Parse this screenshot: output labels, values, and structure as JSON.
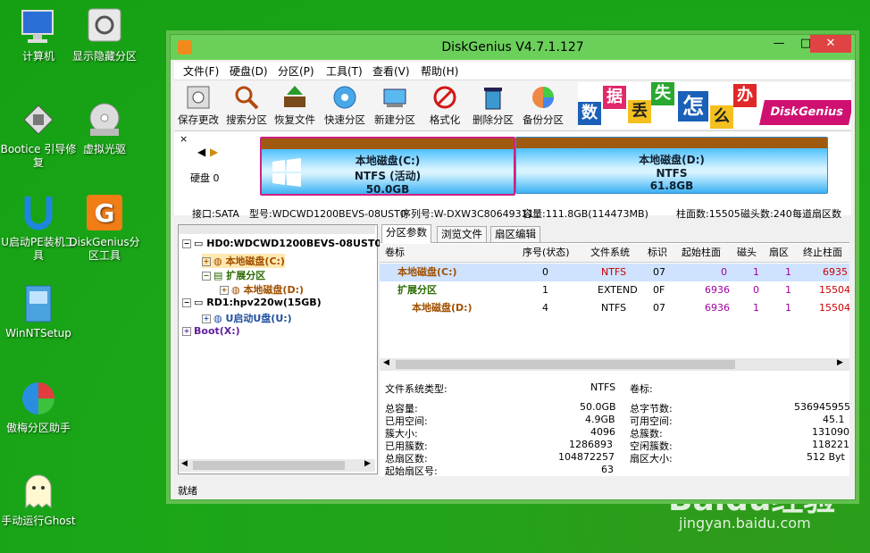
{
  "desktop": {
    "icons": [
      {
        "label": "计算机"
      },
      {
        "label": "显示隐藏分区"
      },
      {
        "label": "Bootice 引导修复"
      },
      {
        "label": "虚拟光驱"
      },
      {
        "label": "U启动PE装机工具"
      },
      {
        "label": "DiskGenius分区工具"
      },
      {
        "label": "WinNTSetup"
      },
      {
        "label": "傲梅分区助手"
      },
      {
        "label": "手动运行Ghost"
      }
    ],
    "watermark": "Baidu经验",
    "watermark_url": "jingyan.baidu.com"
  },
  "window": {
    "title": "DiskGenius V4.7.1.127",
    "minimize": "—",
    "maximize": "□",
    "close": "✕"
  },
  "menu": [
    "文件(F)",
    "硬盘(D)",
    "分区(P)",
    "工具(T)",
    "查看(V)",
    "帮助(H)"
  ],
  "toolbar": [
    {
      "label": "保存更改",
      "icon": "save-icon"
    },
    {
      "label": "搜索分区",
      "icon": "search-icon"
    },
    {
      "label": "恢复文件",
      "icon": "recover-icon"
    },
    {
      "label": "快速分区",
      "icon": "quick-partition-icon"
    },
    {
      "label": "新建分区",
      "icon": "new-partition-icon"
    },
    {
      "label": "格式化",
      "icon": "format-icon"
    },
    {
      "label": "删除分区",
      "icon": "delete-icon"
    },
    {
      "label": "备份分区",
      "icon": "backup-icon"
    }
  ],
  "banner": {
    "chars": [
      "数",
      "据",
      "丢",
      "失",
      "怎",
      "么",
      "办"
    ],
    "brand": "DiskGenius"
  },
  "diskbar": {
    "close": "×",
    "disk_label": "硬盘 0",
    "partitions": [
      {
        "name": "本地磁盘(C:)",
        "fs": "NTFS (活动)",
        "size": "50.0GB"
      },
      {
        "name": "本地磁盘(D:)",
        "fs": "NTFS",
        "size": "61.8GB"
      }
    ]
  },
  "diskinfo": {
    "interface": "接口:SATA",
    "model": "型号:WDCWD1200BEVS-08UST0",
    "serial": "序列号:W-DXW3C80649311",
    "capacity": "容量:111.8GB(114473MB)",
    "cylinders": "柱面数:15505",
    "heads": "磁头数:240",
    "sectors": "每道扇区数"
  },
  "tree": [
    {
      "text": "HD0:WDCWD1200BEVS-08UST0",
      "level": 0,
      "exp": "−"
    },
    {
      "text": "本地磁盘(C:)",
      "level": 1,
      "exp": "+"
    },
    {
      "text": "扩展分区",
      "level": 1,
      "exp": "−"
    },
    {
      "text": "本地磁盘(D:)",
      "level": 2,
      "exp": "+"
    },
    {
      "text": "RD1:hpv220w(15GB)",
      "level": 0,
      "exp": "−"
    },
    {
      "text": "U启动U盘(U:)",
      "level": 1,
      "exp": "+"
    },
    {
      "text": "Boot(X:)",
      "level": 0,
      "exp": "+"
    }
  ],
  "tabs": [
    "分区参数",
    "浏览文件",
    "扇区编辑"
  ],
  "table": {
    "headers": [
      "卷标",
      "序号(状态)",
      "文件系统",
      "标识",
      "起始柱面",
      "磁头",
      "扇区",
      "终止柱面"
    ],
    "rows": [
      [
        "本地磁盘(C:)",
        "0",
        "NTFS",
        "07",
        "0",
        "1",
        "1",
        "6935"
      ],
      [
        "扩展分区",
        "1",
        "EXTEND",
        "0F",
        "6936",
        "0",
        "1",
        "15504"
      ],
      [
        "本地磁盘(D:)",
        "4",
        "NTFS",
        "07",
        "6936",
        "1",
        "1",
        "15504"
      ]
    ]
  },
  "props": {
    "fs_type_label": "文件系统类型:",
    "fs_type": "NTFS",
    "vol_label": "卷标:",
    "left": [
      [
        "总容量:",
        "50.0GB"
      ],
      [
        "已用空间:",
        "4.9GB"
      ],
      [
        "簇大小:",
        "4096"
      ],
      [
        "已用簇数:",
        "1286893"
      ],
      [
        "总扇区数:",
        "104872257"
      ],
      [
        "起始扇区号:",
        "63"
      ]
    ],
    "right": [
      [
        "总字节数:",
        "536945955"
      ],
      [
        "可用空间:",
        "45.1"
      ],
      [
        "总簇数:",
        "131090"
      ],
      [
        "空闲簇数:",
        "118221"
      ],
      [
        "扇区大小:",
        "512 Byt"
      ]
    ]
  },
  "status": "就绪"
}
